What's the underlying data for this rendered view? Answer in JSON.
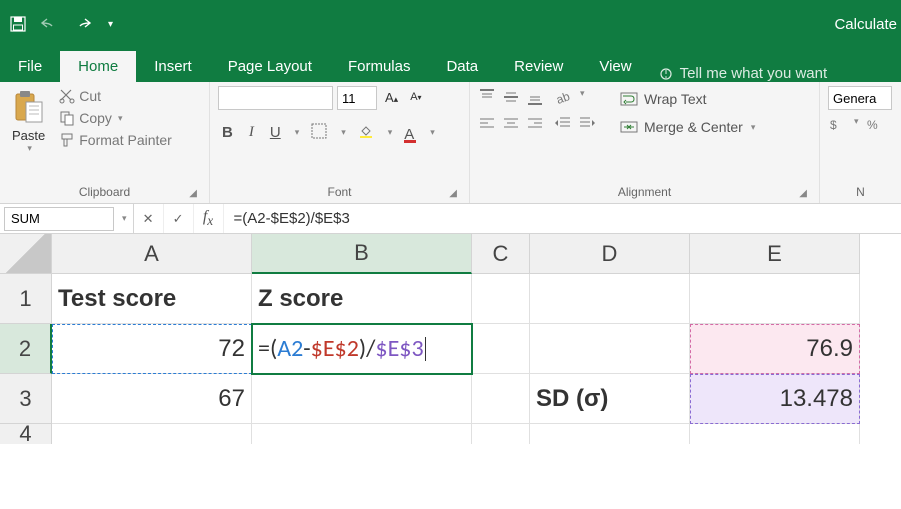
{
  "titlebar": {
    "right_text": "Calculate"
  },
  "tabs": {
    "file": "File",
    "home": "Home",
    "insert": "Insert",
    "page_layout": "Page Layout",
    "formulas": "Formulas",
    "data": "Data",
    "review": "Review",
    "view": "View",
    "tellme": "Tell me what you want"
  },
  "ribbon": {
    "clipboard": {
      "label": "Clipboard",
      "paste": "Paste",
      "cut": "Cut",
      "copy": "Copy",
      "format_painter": "Format Painter"
    },
    "font": {
      "label": "Font",
      "name": "",
      "size": "11"
    },
    "alignment": {
      "label": "Alignment",
      "wrap": "Wrap Text",
      "merge": "Merge & Center"
    },
    "number": {
      "label": "N",
      "format": "Genera"
    }
  },
  "formula_bar": {
    "name": "SUM",
    "formula": "=(A2-$E$2)/$E$3"
  },
  "columns": [
    "A",
    "B",
    "C",
    "D",
    "E"
  ],
  "rows": [
    "1",
    "2",
    "3",
    "4"
  ],
  "cells": {
    "A1": "Test score",
    "B1": "Z score",
    "A2": "72",
    "A3": "67",
    "D3": "SD (σ)",
    "E2": "76.9",
    "E3": "13.478",
    "B2_formula_parts": {
      "p1": "=(",
      "ref1": "A2",
      "p2": "-",
      "ref2": "$E$2",
      "p3": ")/",
      "ref3": "$E$3"
    }
  }
}
